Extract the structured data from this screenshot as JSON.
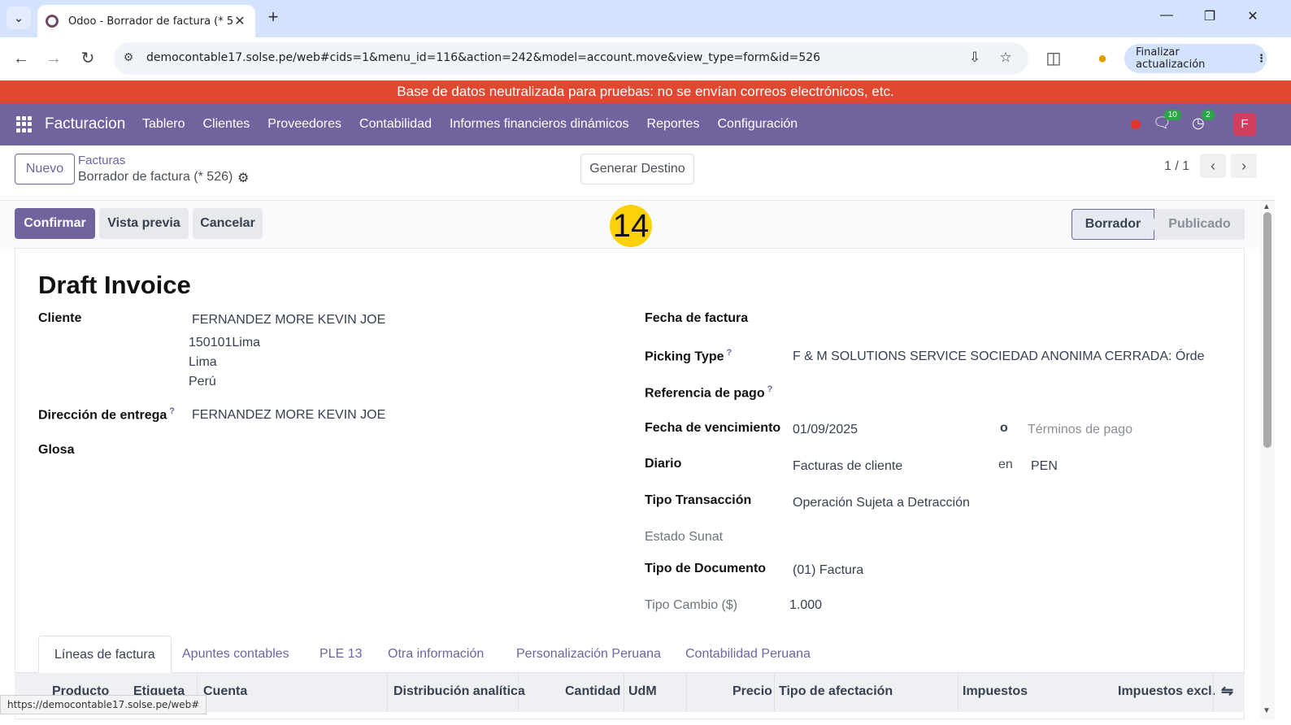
{
  "browser": {
    "tab_title": "Odoo - Borrador de factura (* 5",
    "url": "democontable17.solse.pe/web#cids=1&menu_id=116&action=242&model=account.move&view_type=form&id=526",
    "update_button": "Finalizar actualización",
    "status_url": "https://democontable17.solse.pe/web#"
  },
  "banner": "Base de datos neutralizada para pruebas: no se envían correos electrónicos, etc.",
  "navbar": {
    "brand": "Facturacion",
    "menu": [
      "Tablero",
      "Clientes",
      "Proveedores",
      "Contabilidad",
      "Informes financieros dinámicos",
      "Reportes",
      "Configuración"
    ],
    "messages_count": "10",
    "activities_count": "2",
    "avatar_letter": "F"
  },
  "control": {
    "new_button": "Nuevo",
    "breadcrumb_parent": "Facturas",
    "breadcrumb_current": "Borrador de factura (* 526)",
    "generate_button": "Generar Destino",
    "pager": "1 / 1"
  },
  "actions": {
    "confirm": "Confirmar",
    "preview": "Vista previa",
    "cancel": "Cancelar",
    "marker": "14"
  },
  "status": {
    "draft": "Borrador",
    "posted": "Publicado"
  },
  "form": {
    "title": "Draft Invoice",
    "left": {
      "cliente_label": "Cliente",
      "cliente_name": "FERNANDEZ MORE KEVIN JOE",
      "cliente_addr1": "150101Lima",
      "cliente_addr2": "Lima",
      "cliente_addr3": "Perú",
      "entrega_label": "Dirección de entrega",
      "entrega_value": "FERNANDEZ MORE KEVIN JOE",
      "glosa_label": "Glosa"
    },
    "right": {
      "fecha_factura_label": "Fecha de factura",
      "picking_label": "Picking Type",
      "picking_value": "F & M SOLUTIONS SERVICE SOCIEDAD ANONIMA CERRADA: Órde",
      "ref_pago_label": "Referencia de pago",
      "vencimiento_label": "Fecha de vencimiento",
      "vencimiento_value": "01/09/2025",
      "o_text": "o",
      "terminos_placeholder": "Términos de pago",
      "diario_label": "Diario",
      "diario_value": "Facturas de cliente",
      "en_text": "en",
      "currency": "PEN",
      "tipo_trans_label": "Tipo Transacción",
      "tipo_trans_value": "Operación Sujeta a Detracción",
      "estado_sunat_label": "Estado Sunat",
      "tipo_doc_label": "Tipo de Documento",
      "tipo_doc_value": "(01) Factura",
      "tipo_cambio_label": "Tipo Cambio ($)",
      "tipo_cambio_value": "1.000"
    },
    "tabs": [
      "Líneas de factura",
      "Apuntes contables",
      "PLE 13",
      "Otra información",
      "Personalización Peruana",
      "Contabilidad Peruana"
    ],
    "columns": [
      "Producto",
      "Etiqueta",
      "Cuenta",
      "Distribución analítica",
      "Cantidad",
      "UdM",
      "Precio",
      "Tipo de afectación",
      "Impuestos",
      "Impuestos excl."
    ]
  }
}
